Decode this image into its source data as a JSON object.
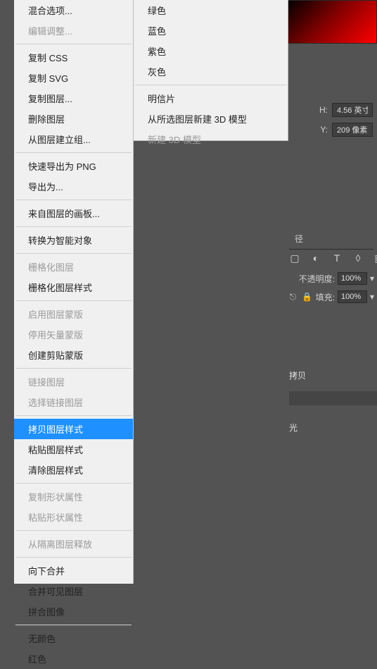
{
  "bg": {
    "h_label": "H:",
    "h_value": "4.56 英寸",
    "y_label": "Y:",
    "y_value": "209 像素",
    "tab_paths": "径",
    "opacity_label": "不透明度:",
    "opacity_value": "100%",
    "fill_label": "填充:",
    "fill_value": "100%",
    "layer_copy": "拷贝",
    "layer_glow": "光"
  },
  "menu1": {
    "blending_options": "混合选项...",
    "edit_adjustment": "编辑调整...",
    "copy_css": "复制 CSS",
    "copy_svg": "复制 SVG",
    "duplicate_layer": "复制图层...",
    "delete_layer": "删除图层",
    "group_from_layers": "从图层建立组...",
    "quick_export_png": "快速导出为 PNG",
    "export_as": "导出为...",
    "artboard_from_layers": "来自图层的画板...",
    "convert_smart_object": "转换为智能对象",
    "rasterize_layer": "栅格化图层",
    "rasterize_layer_style": "栅格化图层样式",
    "enable_layer_mask": "启用图层蒙版",
    "disable_vector_mask": "停用矢量蒙版",
    "create_clipping_mask": "创建剪贴蒙版",
    "link_layers": "链接图层",
    "select_linked_layers": "选择链接图层",
    "copy_layer_style": "拷贝图层样式",
    "paste_layer_style": "粘贴图层样式",
    "clear_layer_style": "清除图层样式",
    "copy_shape_attrs": "复制形状属性",
    "paste_shape_attrs": "粘贴形状属性",
    "release_isolation": "从隔离图层释放",
    "merge_down": "向下合并",
    "merge_visible": "合并可见图层",
    "flatten_image": "拼合图像",
    "no_color": "无颜色",
    "red": "红色"
  },
  "menu2": {
    "green": "绿色",
    "blue": "蓝色",
    "purple": "紫色",
    "gray": "灰色",
    "postcard": "明信片",
    "new_3d_from_selected": "从所选图层新建 3D 模型",
    "new_3d_model": "新建 3D 模型"
  }
}
